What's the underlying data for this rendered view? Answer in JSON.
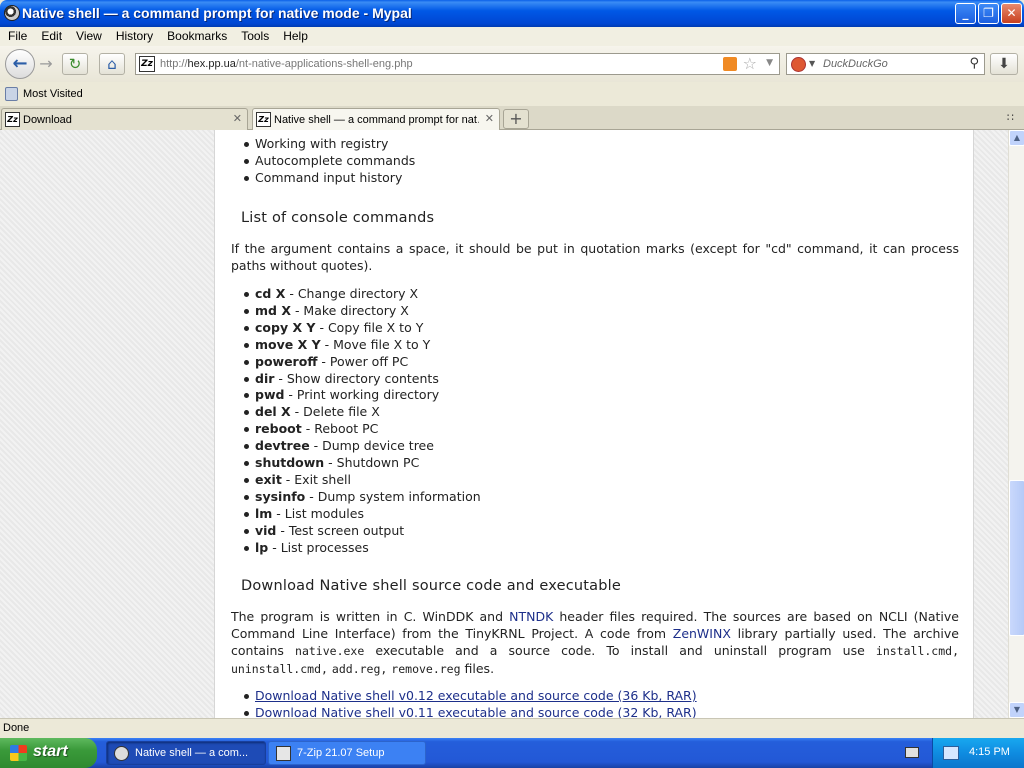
{
  "window": {
    "title": "Native shell — a command prompt for native mode - Mypal",
    "minimize_label": "_",
    "maximize_label": "❐",
    "close_label": "✕"
  },
  "menu": {
    "file": "File",
    "edit": "Edit",
    "view": "View",
    "history": "History",
    "bookmarks": "Bookmarks",
    "tools": "Tools",
    "help": "Help"
  },
  "navbar": {
    "url_prefix": "http://",
    "url_host": "hex.pp.ua",
    "url_path": "/nt-native-applications-shell-eng.php",
    "site_icon_text": "Zz",
    "search_placeholder": "DuckDuckGo",
    "icons": {
      "back": "←",
      "forward": "→",
      "reload": "↻",
      "home": "⌂",
      "download": "⬇",
      "star": "☆",
      "magnifier": "⚲"
    }
  },
  "bookmarks_bar": {
    "most_visited": "Most Visited"
  },
  "tabs": [
    {
      "label": "Download",
      "fav": "Zz",
      "active": false
    },
    {
      "label": "Native shell — a command prompt for nat…",
      "fav": "Zz",
      "active": true
    }
  ],
  "newtab_label": "+",
  "tablist_label": "∷",
  "content": {
    "features": [
      "Working with registry",
      "Autocomplete commands",
      "Command input history"
    ],
    "section1_title": "List of console commands",
    "section1_intro": "If the argument contains a space, it should be put in quotation marks (except for \"cd\" command, it can process paths without quotes).",
    "commands": [
      {
        "cmd": "cd X",
        "desc": " - Change directory X"
      },
      {
        "cmd": "md X",
        "desc": " - Make directory X"
      },
      {
        "cmd": "copy X Y",
        "desc": " - Copy file X to Y"
      },
      {
        "cmd": "move X Y",
        "desc": " - Move file X to Y"
      },
      {
        "cmd": "poweroff",
        "desc": " - Power off PC"
      },
      {
        "cmd": "dir",
        "desc": " - Show directory contents"
      },
      {
        "cmd": "pwd",
        "desc": " - Print working directory"
      },
      {
        "cmd": "del X",
        "desc": " - Delete file X"
      },
      {
        "cmd": "reboot",
        "desc": " - Reboot PC"
      },
      {
        "cmd": "devtree",
        "desc": " - Dump device tree"
      },
      {
        "cmd": "shutdown",
        "desc": " - Shutdown PC"
      },
      {
        "cmd": "exit",
        "desc": " - Exit shell"
      },
      {
        "cmd": "sysinfo",
        "desc": " - Dump system information"
      },
      {
        "cmd": "lm",
        "desc": " - List modules"
      },
      {
        "cmd": "vid",
        "desc": " - Test screen output"
      },
      {
        "cmd": "lp",
        "desc": " - List processes"
      }
    ],
    "section2_title": "Download Native shell source code and executable",
    "section2_p": {
      "t1": "The program is written in C. WinDDK and ",
      "link_ntndk": "NTNDK",
      "t2": " header files required. The sources are based on NCLI (Native Command Line Interface) from the TinyKRNL Project. A code from ",
      "link_zenwinx": "ZenWINX",
      "t3": " library partially used. The archive contains ",
      "code_native": "native.exe",
      "t4": " executable and a source code. To install and uninstall program use ",
      "code_install": "install.cmd,",
      "t5": " ",
      "code_uninstall": "uninstall.cmd,",
      "t6": " ",
      "code_add": "add.reg,",
      "t7": " ",
      "code_remove": "remove.reg",
      "t8": " files."
    },
    "downloads": [
      "Download Native shell v0.12 executable and source code (36 Kb, RAR)",
      "Download Native shell v0.11 executable and source code (32 Kb, RAR)"
    ]
  },
  "statusbar": {
    "text": "Done"
  },
  "taskbar": {
    "start_label": "start",
    "tasks": [
      {
        "label": "Native shell — a com...",
        "active": true
      },
      {
        "label": "7-Zip 21.07 Setup",
        "active": false
      }
    ],
    "clock": "4:15 PM"
  }
}
